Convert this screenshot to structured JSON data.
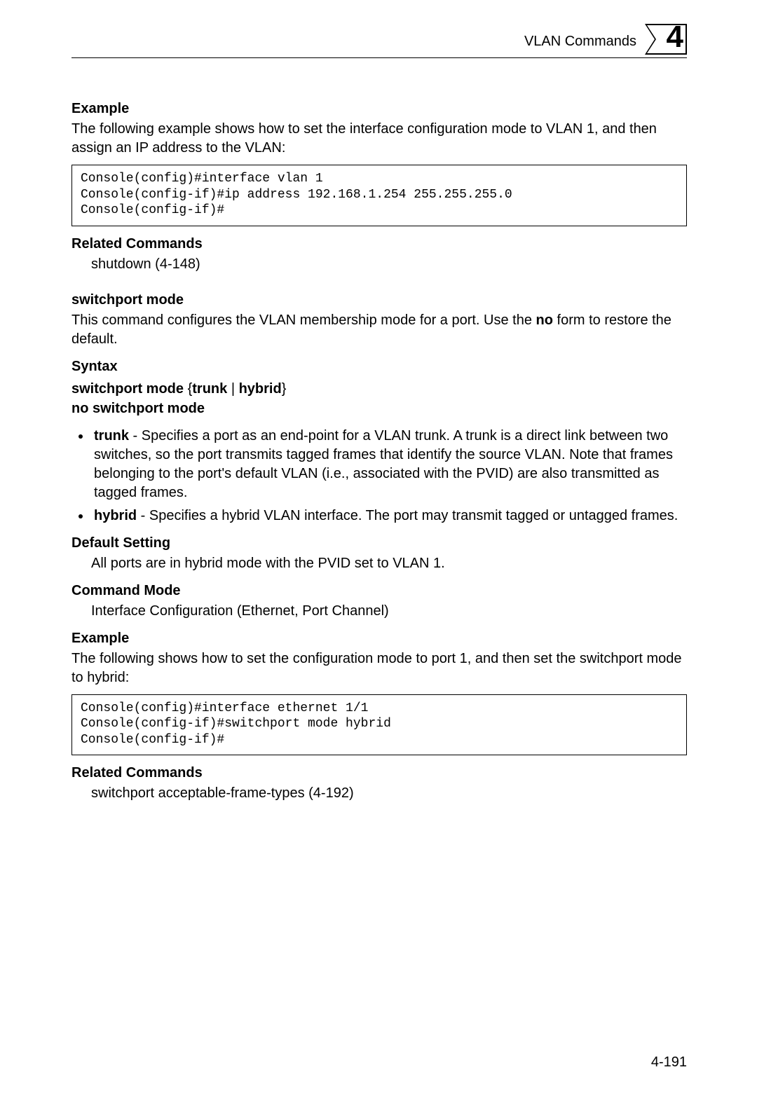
{
  "header": {
    "section_title": "VLAN Commands",
    "chapter_number": "4"
  },
  "example1": {
    "heading": "Example",
    "intro": "The following example shows how to set the interface configuration mode to VLAN 1, and then assign an IP address to the VLAN:",
    "code": "Console(config)#interface vlan 1\nConsole(config-if)#ip address 192.168.1.254 255.255.255.0\nConsole(config-if)#"
  },
  "related1": {
    "heading": "Related Commands",
    "item": "shutdown (4-148)"
  },
  "switchport_mode": {
    "heading": "switchport mode",
    "intro_a": "This command configures the VLAN membership mode for a port. Use the ",
    "intro_bold": "no",
    "intro_b": " form to restore the default."
  },
  "syntax": {
    "heading": "Syntax",
    "line1_a": "switchport mode",
    "line1_b": " {",
    "line1_c": "trunk",
    "line1_d": " | ",
    "line1_e": "hybrid",
    "line1_f": "}",
    "line2": "no switchport mode",
    "bullets": {
      "trunk_term": "trunk",
      "trunk_desc": " - Specifies a port as an end-point for a VLAN trunk. A trunk is a direct link between two switches, so the port transmits tagged frames that identify the source VLAN. Note that frames belonging to the port's default VLAN (i.e., associated with the PVID) are also transmitted as tagged frames.",
      "hybrid_term": "hybrid",
      "hybrid_desc": " - Specifies a hybrid VLAN interface. The port may transmit tagged or untagged frames."
    }
  },
  "default_setting": {
    "heading": "Default Setting",
    "text": "All ports are in hybrid mode with the PVID set to VLAN 1."
  },
  "command_mode": {
    "heading": "Command Mode",
    "text": "Interface Configuration (Ethernet, Port Channel)"
  },
  "example2": {
    "heading": "Example",
    "intro": "The following shows how to set the configuration mode to port 1, and then set the switchport mode to hybrid:",
    "code": "Console(config)#interface ethernet 1/1\nConsole(config-if)#switchport mode hybrid\nConsole(config-if)#"
  },
  "related2": {
    "heading": "Related Commands",
    "item": "switchport acceptable-frame-types (4-192)"
  },
  "footer": {
    "page_number": "4-191"
  }
}
